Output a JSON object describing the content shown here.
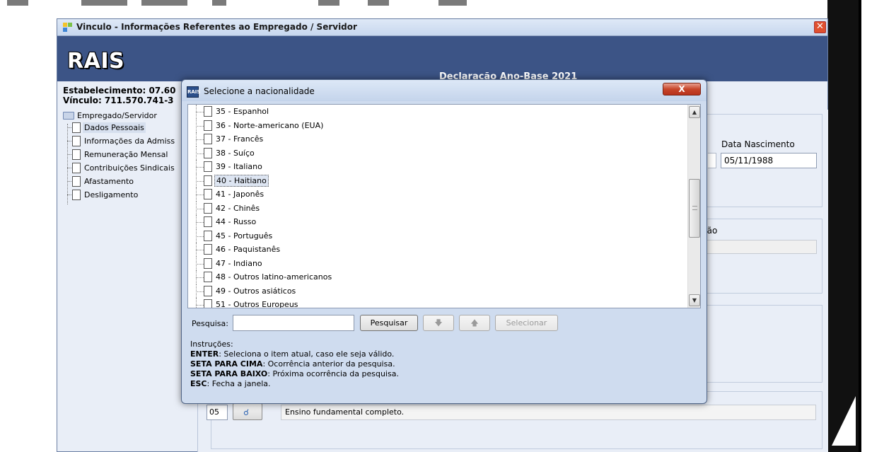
{
  "main_window": {
    "title": "Vinculo - Informações Referentes ao Empregado / Servidor",
    "close_glyph": "✕",
    "logo": "RAIS",
    "year_label": "Declaração Ano-Base 2021",
    "establishment": "Estabelecimento: 07.60",
    "vinculo": "Vínculo: 711.570.741-3",
    "tree": {
      "root": "Empregado/Servidor",
      "items": [
        "Dados Pessoais",
        "Informações da Admiss",
        "Remuneração Mensal",
        "Contribuições Sindicais",
        "Afastamento",
        "Desligamento"
      ]
    },
    "birth_date_label": "Data Nascimento",
    "birth_date_value": "05/11/1988",
    "partial_label": "ção",
    "education_code": "05",
    "education_desc": "Ensino fundamental completo."
  },
  "dialog": {
    "title": "Selecione a nacionalidade",
    "close_glyph": "X",
    "items": [
      "35 - Espanhol",
      "36 - Norte-americano (EUA)",
      "37 - Francês",
      "38 - Suíço",
      "39 - Italiano",
      "40 - Haitiano",
      "41 - Japonês",
      "42 - Chinês",
      "44 - Russo",
      "45 - Português",
      "46 - Paquistanês",
      "47 - Indiano",
      "48 - Outros latino-americanos",
      "49 - Outros asiáticos",
      "51 - Outros Europeus"
    ],
    "selected_index": 5,
    "search_label": "Pesquisa:",
    "search_value": "",
    "search_button": "Pesquisar",
    "down_glyph": "🡇",
    "up_glyph": "🡅",
    "select_button": "Selecionar",
    "instructions": {
      "heading": "Instruções:",
      "lines": [
        {
          "key": "ENTER",
          "text": ": Seleciona o item atual, caso ele seja válido."
        },
        {
          "key": "SETA PARA CIMA",
          "text": ": Ocorrência anterior da pesquisa."
        },
        {
          "key": "SETA PARA BAIXO",
          "text": ": Próxima ocorrência da pesquisa."
        },
        {
          "key": "ESC",
          "text": ": Fecha a janela."
        }
      ]
    }
  }
}
